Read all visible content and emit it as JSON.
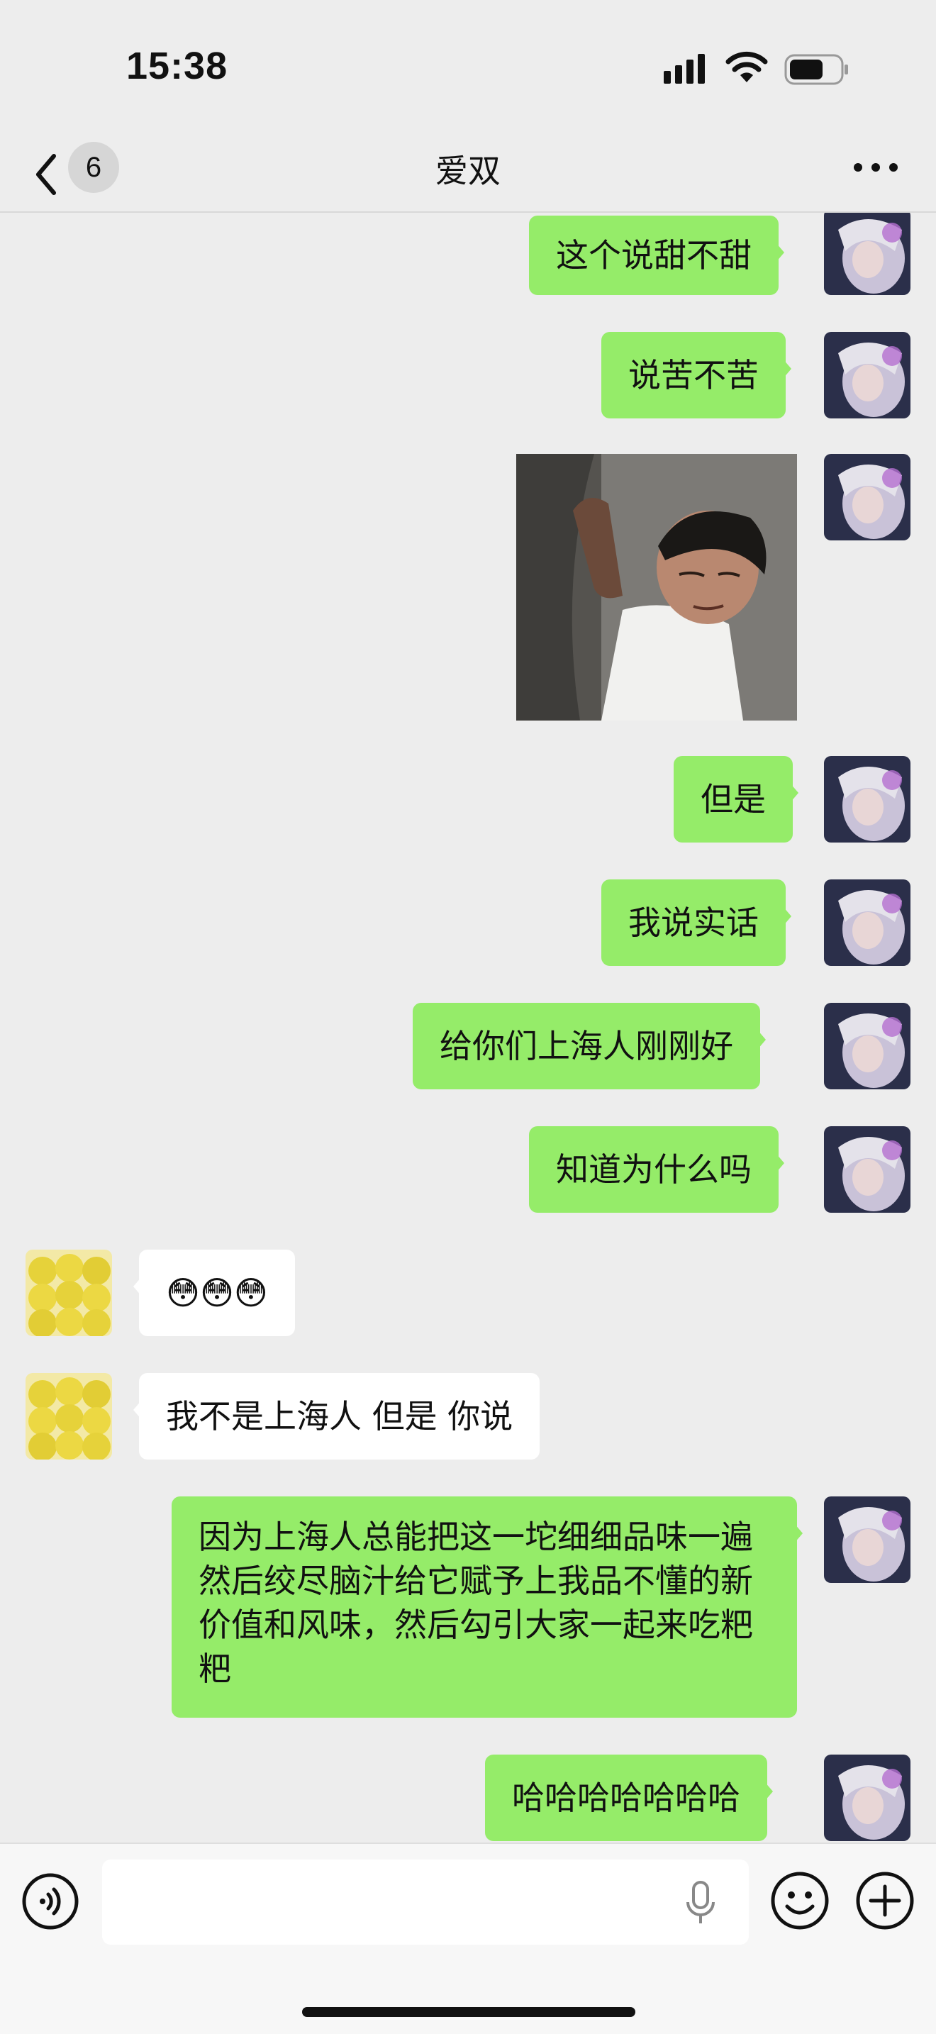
{
  "status": {
    "time": "15:38"
  },
  "header": {
    "back_count": "6",
    "title": "爱双"
  },
  "messages": [
    {
      "side": "me",
      "text": "这个说甜不甜"
    },
    {
      "side": "me",
      "text": "说苦不苦"
    },
    {
      "side": "me",
      "type": "image",
      "description": "meme image"
    },
    {
      "side": "me",
      "text": "但是"
    },
    {
      "side": "me",
      "text": "我说实话"
    },
    {
      "side": "me",
      "text": "给你们上海人刚刚好"
    },
    {
      "side": "me",
      "text": "知道为什么吗"
    },
    {
      "side": "other",
      "text": "😳😳😳"
    },
    {
      "side": "other",
      "text": "我不是上海人 但是 你说"
    },
    {
      "side": "me",
      "text": "因为上海人总能把这一坨细细品味一遍然后绞尽脑汁给它赋予上我品不懂的新价值和风味，然后勾引大家一起来吃粑粑"
    },
    {
      "side": "me",
      "text": "哈哈哈哈哈哈哈"
    }
  ],
  "colors": {
    "my_bubble": "#95ec69",
    "other_bubble": "#ffffff",
    "background": "#ededed"
  },
  "icons": [
    "back-chevron-icon",
    "more-dots-icon",
    "voice-icon",
    "mic-icon",
    "emoji-icon",
    "plus-icon",
    "signal-icon",
    "wifi-icon",
    "battery-icon"
  ]
}
